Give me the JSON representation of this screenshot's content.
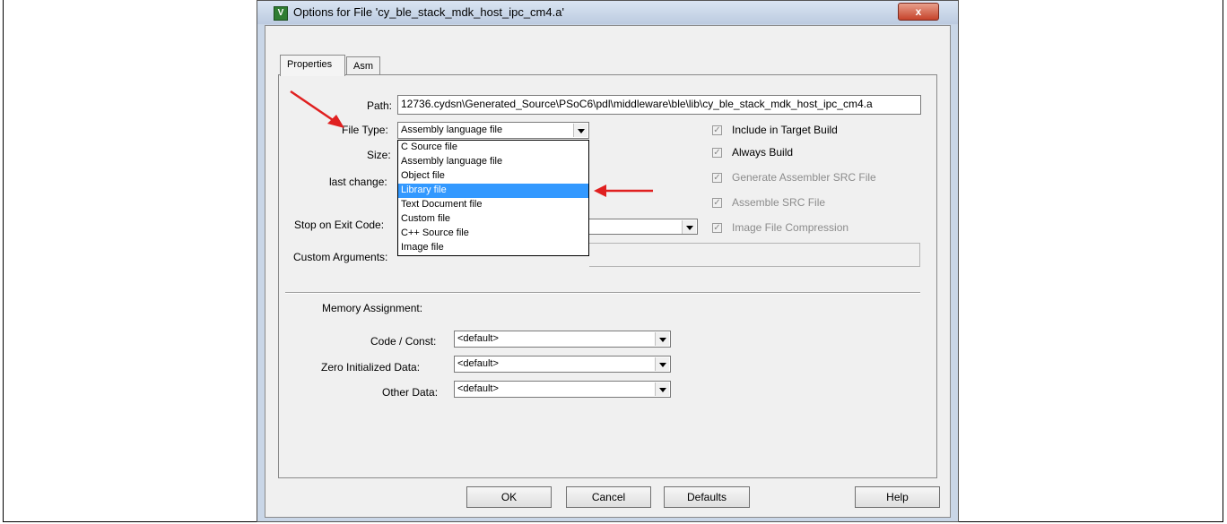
{
  "window": {
    "title": "Options for File 'cy_ble_stack_mdk_host_ipc_cm4.a'",
    "app_icon": "keil-uvision-icon",
    "close_label": "x"
  },
  "tabs": [
    {
      "label": "Properties",
      "active": true
    },
    {
      "label": "Asm",
      "active": false
    }
  ],
  "properties": {
    "path_label": "Path:",
    "path_value": "12736.cydsn\\Generated_Source\\PSoC6\\pdl\\middleware\\ble\\lib\\cy_ble_stack_mdk_host_ipc_cm4.a",
    "file_type_label": "File Type:",
    "file_type_value": "Assembly language file",
    "size_label": "Size:",
    "last_change_label": "last change:",
    "stop_on_exit_label": "Stop on Exit Code:",
    "custom_args_label": "Custom Arguments:"
  },
  "file_type_options": [
    "C Source file",
    "Assembly language file",
    "Object file",
    "Library file",
    "Text Document file",
    "Custom file",
    "C++ Source file",
    "Image file"
  ],
  "highlighted_option": "Library file",
  "checkboxes": [
    {
      "label": "Include in Target Build",
      "checked": true,
      "enabled": true
    },
    {
      "label": "Always Build",
      "checked": true,
      "enabled": true
    },
    {
      "label": "Generate Assembler SRC File",
      "checked": true,
      "enabled": false
    },
    {
      "label": "Assemble SRC File",
      "checked": true,
      "enabled": false
    },
    {
      "label": "Image File Compression",
      "checked": true,
      "enabled": false
    }
  ],
  "memory": {
    "heading": "Memory Assignment:",
    "code_const_label": "Code / Const:",
    "code_const_value": "<default>",
    "zero_init_label": "Zero Initialized Data:",
    "zero_init_value": "<default>",
    "other_data_label": "Other Data:",
    "other_data_value": "<default>"
  },
  "buttons": {
    "ok": "OK",
    "cancel": "Cancel",
    "defaults": "Defaults",
    "help": "Help"
  },
  "annotation_color": "#e02020"
}
